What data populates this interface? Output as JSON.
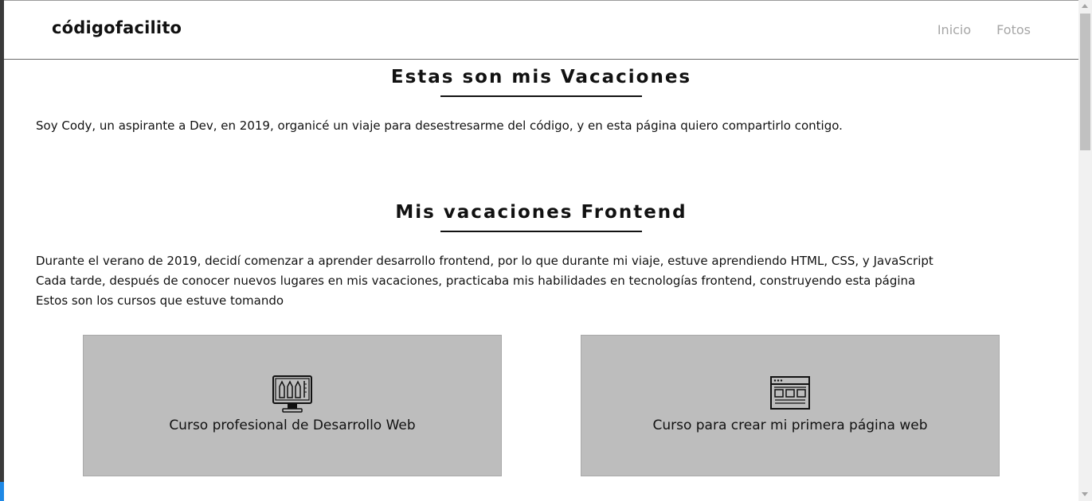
{
  "header": {
    "logo": "códigofacilito",
    "nav": [
      {
        "label": "Inicio"
      },
      {
        "label": "Fotos"
      }
    ]
  },
  "sections": [
    {
      "title": "Estas son mis Vacaciones",
      "paragraphs": [
        "Soy Cody, un aspirante a Dev, en 2019, organicé un viaje para desestresarme del código, y en esta página quiero compartirlo contigo."
      ]
    },
    {
      "title": "Mis vacaciones Frontend",
      "paragraphs": [
        "Durante el verano de 2019, decidí comenzar a aprender desarrollo frontend, por lo que durante mi viaje, estuve aprendiendo HTML, CSS, y JavaScript",
        "Cada tarde, después de conocer nuevos lugares en mis vacaciones, practicaba mis habilidades en tecnologías frontend, construyendo esta página",
        "Estos son los cursos que estuve tomando"
      ]
    }
  ],
  "courses": [
    {
      "title": "Curso profesional de Desarrollo Web",
      "icon": "design-monitor-icon"
    },
    {
      "title": "Curso para crear mi primera página web",
      "icon": "webpage-layout-icon"
    }
  ],
  "colors": {
    "card_background": "#bdbdbd",
    "nav_text": "#a6a6a6",
    "text": "#111111"
  }
}
